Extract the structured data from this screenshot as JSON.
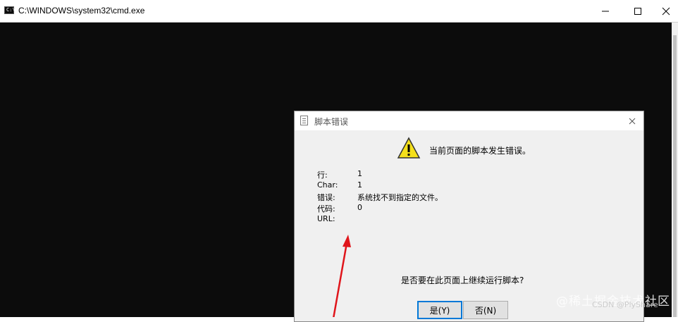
{
  "window": {
    "title": "C:\\WINDOWS\\system32\\cmd.exe",
    "icon_text": "C:\\",
    "minimize_icon": "minimize-icon",
    "maximize_icon": "maximize-icon",
    "close_icon": "close-icon"
  },
  "dialog": {
    "title": "脚本错误",
    "headline": "当前页面的脚本发生错误。",
    "details": [
      {
        "label": "行:",
        "value": "1"
      },
      {
        "label": "Char:",
        "value": "1"
      },
      {
        "label": "错误:",
        "value": "系统找不到指定的文件。"
      },
      {
        "label": "代码:",
        "value": "0"
      },
      {
        "label": "URL:",
        "value": ""
      }
    ],
    "question": "是否要在此页面上继续运行脚本?",
    "yes_button": "是(Y)",
    "no_button": "否(N)",
    "warning_icon": "warning-icon"
  },
  "overlay": {
    "watermark": "@稀土掘金技术社区",
    "watermark_sub": "CSDN @PlyShare",
    "arrow_color": "#e0151b"
  },
  "colors": {
    "console_bg": "#0c0c0c",
    "dialog_bg": "#f0f0f0",
    "accent": "#0078d7"
  }
}
